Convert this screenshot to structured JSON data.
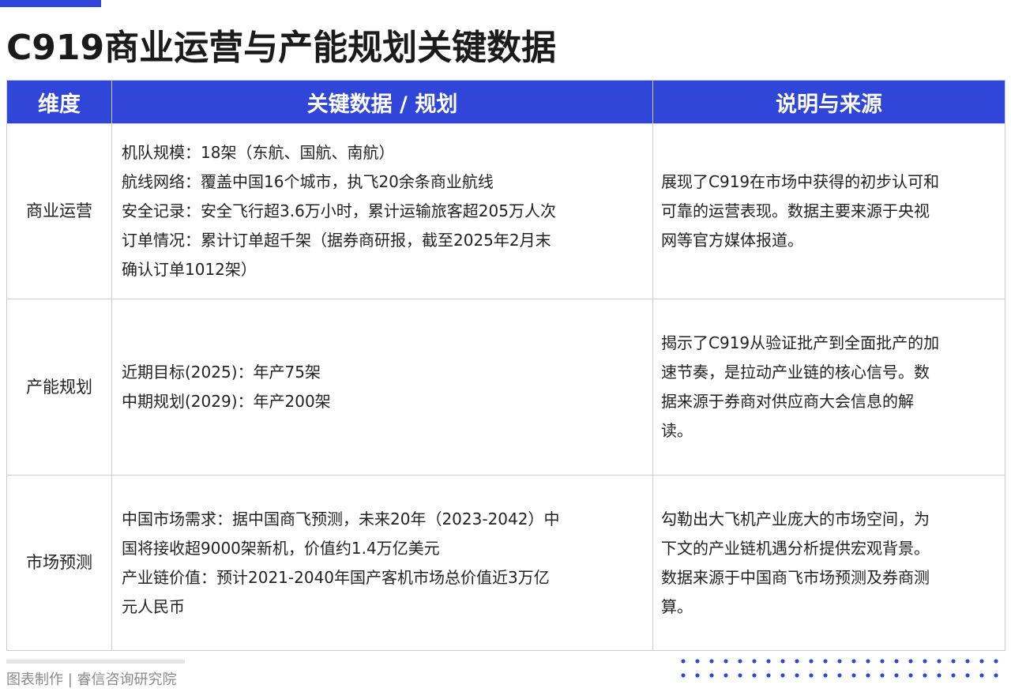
{
  "title": "C919商业运营与产能规划关键数据",
  "colors": {
    "accent": "#2f46d8",
    "border": "#c8ccd8"
  },
  "table": {
    "headers": [
      "维度",
      "关键数据 / 规划",
      "说明与来源"
    ],
    "rows": [
      {
        "dimension": "商业运营",
        "key_lines": [
          "机队规模：18架（东航、国航、南航）",
          "航线网络：覆盖中国16个城市，执飞20余条商业航线",
          "安全记录：安全飞行超3.6万小时，累计运输旅客超205万人次",
          "订单情况：累计订单超千架（据券商研报，截至2025年2月末",
          "确认订单1012架）"
        ],
        "note_lines": [
          "展现了C919在市场中获得的初步认可和",
          "可靠的运营表现。数据主要来源于央视",
          "网等官方媒体报道。"
        ]
      },
      {
        "dimension": "产能规划",
        "key_lines": [
          "近期目标(2025)：年产75架",
          "中期规划(2029)：年产200架"
        ],
        "note_lines": [
          "揭示了C919从验证批产到全面批产的加",
          "速节奏，是拉动产业链的核心信号。数",
          "据来源于券商对供应商大会信息的解",
          "读。"
        ]
      },
      {
        "dimension": "市场预测",
        "key_lines": [
          "中国市场需求：据中国商飞预测，未来20年（2023-2042）中",
          "国将接收超9000架新机，价值约1.4万亿美元",
          "产业链价值：预计2021-2040年国产客机市场总价值近3万亿",
          "元人民币"
        ],
        "note_lines": [
          "勾勒出大飞机产业庞大的市场空间，为",
          "下文的产业链机遇分析提供宏观背景。",
          "数据来源于中国商飞市场预测及券商测",
          "算。"
        ]
      }
    ]
  },
  "footer": {
    "credit": "图表制作 | 睿信咨询研究院"
  }
}
